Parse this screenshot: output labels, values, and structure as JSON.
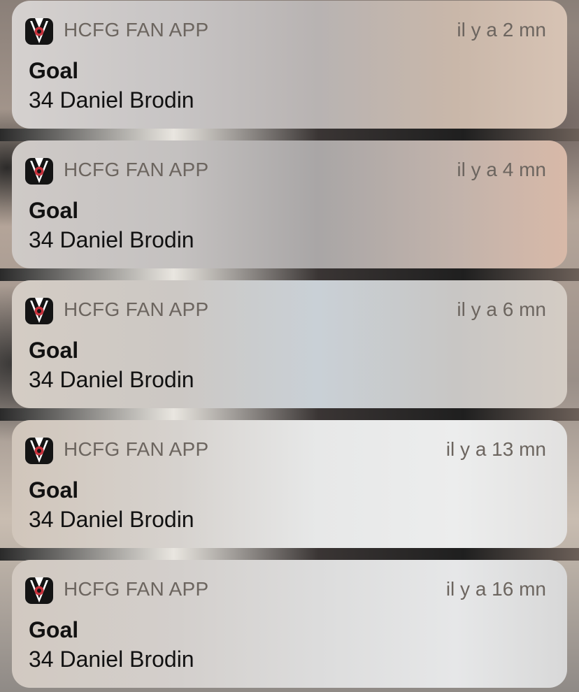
{
  "notifications": [
    {
      "app_name": "HCFG FAN APP",
      "time": "il y a 2 mn",
      "title": "Goal",
      "body": "34 Daniel Brodin",
      "app_icon": "hcfg-logo-icon"
    },
    {
      "app_name": "HCFG FAN APP",
      "time": "il y a 4 mn",
      "title": "Goal",
      "body": "34 Daniel Brodin",
      "app_icon": "hcfg-logo-icon"
    },
    {
      "app_name": "HCFG FAN APP",
      "time": "il y a 6 mn",
      "title": "Goal",
      "body": "34 Daniel Brodin",
      "app_icon": "hcfg-logo-icon"
    },
    {
      "app_name": "HCFG FAN APP",
      "time": "il y a 13 mn",
      "title": "Goal",
      "body": "34 Daniel Brodin",
      "app_icon": "hcfg-logo-icon"
    },
    {
      "app_name": "HCFG FAN APP",
      "time": "il y a 16 mn",
      "title": "Goal",
      "body": "34 Daniel Brodin",
      "app_icon": "hcfg-logo-icon"
    }
  ],
  "colors": {
    "secondary_text": "#6c655f",
    "primary_text": "#111111",
    "logo_accent": "#c8323c"
  }
}
